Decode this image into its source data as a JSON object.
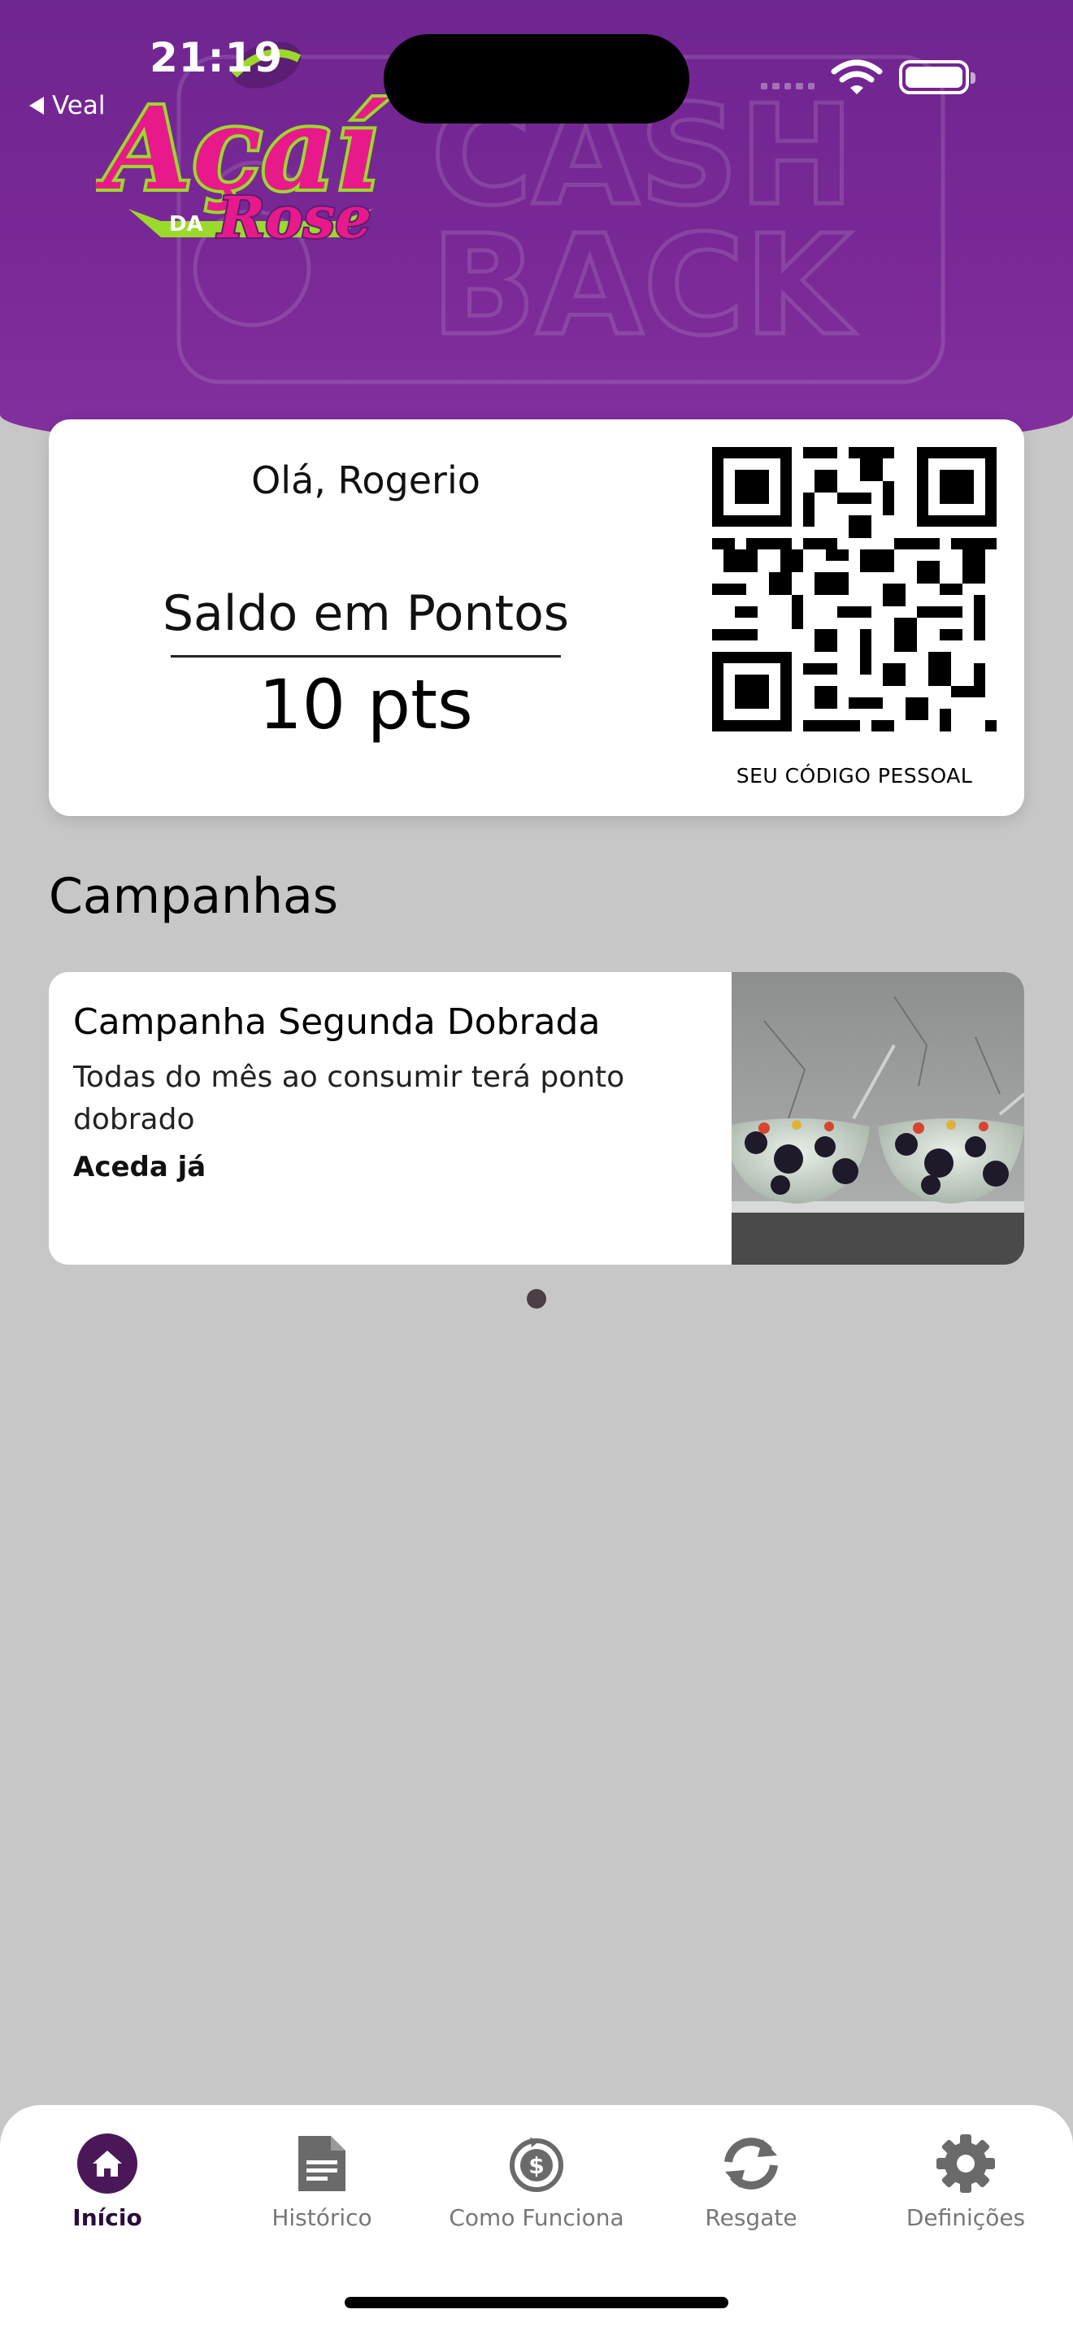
{
  "status_bar": {
    "time": "21:19",
    "back_label": "Veal"
  },
  "header": {
    "logo_text": "Açaí",
    "logo_subtext_da": "DA",
    "logo_subtext_name": "Rose",
    "watermark_line1": "CASH",
    "watermark_line2": "BACK",
    "colors": {
      "primary": "#7a2997",
      "logo_pink": "#e8198b",
      "logo_green": "#9bd92a"
    }
  },
  "points_card": {
    "greeting": "Olá, Rogerio",
    "balance_label": "Saldo em Pontos",
    "balance_value": "10 pts",
    "qr_caption": "SEU CÓDIGO PESSOAL"
  },
  "campaigns": {
    "section_title": "Campanhas",
    "items": [
      {
        "title": "Campanha Segunda Dobrada",
        "description": "Todas do mês ao consumir terá ponto dobrado",
        "cta": "Aceda já"
      }
    ],
    "active_page": 1,
    "total_pages": 1
  },
  "tabbar": {
    "items": [
      {
        "label": "Início",
        "icon": "home-icon",
        "active": true
      },
      {
        "label": "Histórico",
        "icon": "document-icon",
        "active": false
      },
      {
        "label": "Como Funciona",
        "icon": "dollar-cycle-icon",
        "active": false
      },
      {
        "label": "Resgate",
        "icon": "refresh-icon",
        "active": false
      },
      {
        "label": "Definições",
        "icon": "gear-icon",
        "active": false
      }
    ],
    "active_color": "#4a1858"
  }
}
